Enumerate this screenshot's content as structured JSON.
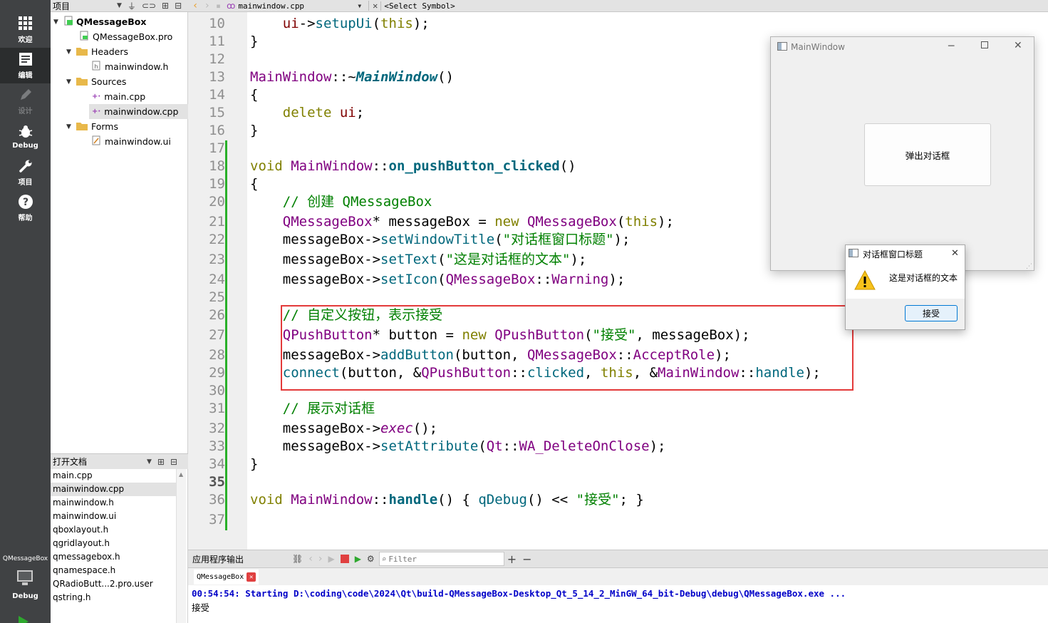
{
  "modes": [
    {
      "label": "欢迎",
      "icon": "grid-icon"
    },
    {
      "label": "编辑",
      "icon": "edit-icon"
    },
    {
      "label": "设计",
      "icon": "pencil-icon"
    },
    {
      "label": "Debug",
      "icon": "bug-icon"
    },
    {
      "label": "项目",
      "icon": "wrench-icon"
    },
    {
      "label": "帮助",
      "icon": "help-icon"
    }
  ],
  "kit": {
    "project": "QMessageBox",
    "mode": "Debug"
  },
  "project_panel": {
    "title": "项目"
  },
  "tree": {
    "root": "QMessageBox",
    "pro": "QMessageBox.pro",
    "headers": "Headers",
    "h1": "mainwindow.h",
    "sources": "Sources",
    "s1": "main.cpp",
    "s2": "mainwindow.cpp",
    "forms": "Forms",
    "f1": "mainwindow.ui"
  },
  "open_docs": {
    "title": "打开文档",
    "items": [
      "main.cpp",
      "mainwindow.cpp",
      "mainwindow.h",
      "mainwindow.ui",
      "qboxlayout.h",
      "qgridlayout.h",
      "qmessagebox.h",
      "qnamespace.h",
      "QRadioButt...2.pro.user",
      "qstring.h"
    ]
  },
  "editor": {
    "file": "mainwindow.cpp",
    "symbol": "<Select Symbol>"
  },
  "code": {
    "line_numbers": [
      "10",
      "11",
      "12",
      "13",
      "14",
      "15",
      "16",
      "17",
      "18",
      "19",
      "20",
      "21",
      "22",
      "23",
      "24",
      "25",
      "26",
      "27",
      "28",
      "29",
      "30",
      "31",
      "32",
      "33",
      "34",
      "35",
      "36",
      "37"
    ],
    "s_title": "\"对话框窗口标题\"",
    "s_text": "\"这是对话框的文本\"",
    "s_accept": "\"接受\"",
    "c_create": "// 创建 QMessageBox",
    "c_custom": "// 自定义按钮，表示接受",
    "c_show": "// 展示对话框"
  },
  "output": {
    "title": "应用程序输出",
    "filter_placeholder": "Filter",
    "tab": "QMessageBox",
    "line1": "00:54:54: Starting D:\\coding\\code\\2024\\Qt\\build-QMessageBox-Desktop_Qt_5_14_2_MinGW_64_bit-Debug\\debug\\QMessageBox.exe ...",
    "line2": "接受"
  },
  "main_window": {
    "title": "MainWindow",
    "button": "弹出对话框"
  },
  "dialog": {
    "title": "对话框窗口标题",
    "text": "这是对话框的文本",
    "button": "接受"
  },
  "colors": {
    "accent": "#0078d4",
    "highlight_box": "#e33a3a",
    "change_bar": "#29b029"
  }
}
